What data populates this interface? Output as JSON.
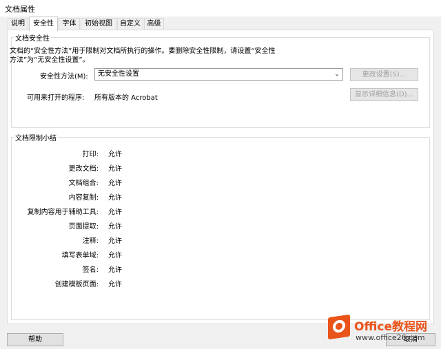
{
  "window": {
    "title": "文档属性"
  },
  "tabs": [
    {
      "label": "说明"
    },
    {
      "label": "安全性"
    },
    {
      "label": "字体"
    },
    {
      "label": "初始视图"
    },
    {
      "label": "自定义"
    },
    {
      "label": "高级"
    }
  ],
  "security": {
    "group_title": "文档安全性",
    "description_line1": "文档的“安全性方法”用于限制对文档所执行的操作。要删除安全性限制，请设置“安全性",
    "description_line2": "方法”为“无安全性设置”。",
    "method_label": "安全性方法(M):",
    "method_value": "无安全性设置",
    "change_button": "更改设置(S)...",
    "open_label": "可用来打开的程序:",
    "open_value": "所有版本的 Acrobat",
    "details_button": "显示详细信息(D)..."
  },
  "summary": {
    "group_title": "文档限制小结",
    "rows": [
      {
        "key": "打印:",
        "value": "允许"
      },
      {
        "key": "更改文档:",
        "value": "允许"
      },
      {
        "key": "文档组合:",
        "value": "允许"
      },
      {
        "key": "内容复制:",
        "value": "允许"
      },
      {
        "key": "复制内容用于辅助工具:",
        "value": "允许"
      },
      {
        "key": "页面提取:",
        "value": "允许"
      },
      {
        "key": "注释:",
        "value": "允许"
      },
      {
        "key": "填写表单域:",
        "value": "允许"
      },
      {
        "key": "签名:",
        "value": "允许"
      },
      {
        "key": "创建模板页面:",
        "value": "允许"
      }
    ]
  },
  "footer": {
    "help_button": "帮助",
    "cancel_button": "取消"
  },
  "watermark": {
    "brand": "Office教程网",
    "sub": "www.office26.com"
  },
  "colors": {
    "accent": "#e9541b"
  }
}
